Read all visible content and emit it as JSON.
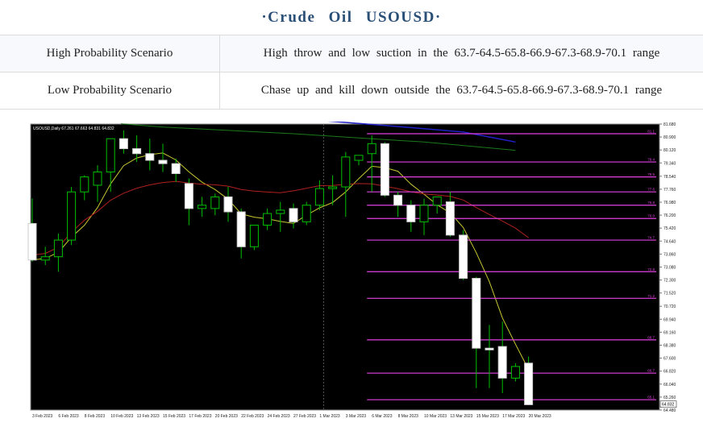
{
  "header": {
    "title": "·Crude  Oil  USOUSD·"
  },
  "scenarios": [
    {
      "label": "High Probability Scenario",
      "text": "High throw and low suction in the 63.7-64.5-65.8-66.9-67.3-68.9-70.1 range"
    },
    {
      "label": "Low Probability Scenario",
      "text": "Chase up and kill down outside the 63.7-64.5-65.8-66.9-67.3-68.9-70.1 range"
    }
  ],
  "chart_data": {
    "type": "candlestick",
    "symbol_label": "USOUSD,Daily  67.261 67.663 64.831 64.832",
    "ylim": [
      64.48,
      81.68
    ],
    "y_ticks": [
      "81.680",
      "80.900",
      "80.120",
      "79.340",
      "78.540",
      "77.760",
      "76.980",
      "76.200",
      "75.420",
      "74.640",
      "73.860",
      "73.080",
      "72.300",
      "71.520",
      "70.720",
      "69.940",
      "69.160",
      "68.380",
      "67.600",
      "66.820",
      "66.040",
      "65.260",
      "64.480"
    ],
    "current_price": "64.832",
    "x_labels": [
      "3 Feb 2023",
      "6 Feb 2023",
      "8 Feb 2023",
      "10 Feb 2023",
      "13 Feb 2023",
      "15 Feb 2023",
      "17 Feb 2023",
      "20 Feb 2023",
      "22 Feb 2023",
      "24 Feb 2023",
      "27 Feb 2023",
      "1 Mar 2023",
      "3 Mar 2023",
      "6 Mar 2023",
      "8 Mar 2023",
      "10 Mar 2023",
      "13 Mar 2023",
      "15 Mar 2023",
      "17 Mar 2023",
      "20 Mar 2023"
    ],
    "candles": [
      {
        "o": 75.7,
        "h": 77.2,
        "l": 73.4,
        "c": 73.5
      },
      {
        "o": 73.5,
        "h": 74.3,
        "l": 73.2,
        "c": 73.7
      },
      {
        "o": 73.7,
        "h": 75.1,
        "l": 72.8,
        "c": 74.7
      },
      {
        "o": 74.7,
        "h": 77.9,
        "l": 74.4,
        "c": 77.6
      },
      {
        "o": 77.6,
        "h": 78.6,
        "l": 77.1,
        "c": 78.5
      },
      {
        "o": 78.0,
        "h": 79.2,
        "l": 77.0,
        "c": 78.8
      },
      {
        "o": 78.8,
        "h": 80.5,
        "l": 77.6,
        "c": 80.8
      },
      {
        "o": 80.8,
        "h": 81.3,
        "l": 79.9,
        "c": 80.2
      },
      {
        "o": 80.2,
        "h": 81.0,
        "l": 79.4,
        "c": 79.9
      },
      {
        "o": 79.9,
        "h": 80.8,
        "l": 78.9,
        "c": 79.5
      },
      {
        "o": 79.5,
        "h": 80.5,
        "l": 78.8,
        "c": 79.3
      },
      {
        "o": 79.3,
        "h": 79.6,
        "l": 78.2,
        "c": 78.7
      },
      {
        "o": 78.1,
        "h": 78.4,
        "l": 75.6,
        "c": 76.6
      },
      {
        "o": 76.6,
        "h": 77.3,
        "l": 76.1,
        "c": 76.8
      },
      {
        "o": 76.6,
        "h": 77.5,
        "l": 76.2,
        "c": 77.3
      },
      {
        "o": 77.3,
        "h": 77.9,
        "l": 75.8,
        "c": 76.4
      },
      {
        "o": 76.4,
        "h": 76.6,
        "l": 73.6,
        "c": 74.3
      },
      {
        "o": 74.3,
        "h": 75.2,
        "l": 74.1,
        "c": 75.6
      },
      {
        "o": 75.6,
        "h": 76.6,
        "l": 75.3,
        "c": 76.3
      },
      {
        "o": 76.3,
        "h": 77.0,
        "l": 75.2,
        "c": 76.5
      },
      {
        "o": 76.6,
        "h": 76.9,
        "l": 75.4,
        "c": 75.8
      },
      {
        "o": 75.8,
        "h": 77.0,
        "l": 75.6,
        "c": 76.8
      },
      {
        "o": 76.8,
        "h": 78.3,
        "l": 76.5,
        "c": 77.8
      },
      {
        "o": 77.8,
        "h": 78.6,
        "l": 76.8,
        "c": 77.9
      },
      {
        "o": 77.9,
        "h": 80.0,
        "l": 76.1,
        "c": 79.7
      },
      {
        "o": 79.5,
        "h": 79.8,
        "l": 79.2,
        "c": 79.8
      },
      {
        "o": 79.9,
        "h": 81.0,
        "l": 77.6,
        "c": 80.5
      },
      {
        "o": 80.5,
        "h": 80.6,
        "l": 77.3,
        "c": 77.4
      },
      {
        "o": 77.4,
        "h": 77.6,
        "l": 76.1,
        "c": 76.8
      },
      {
        "o": 76.8,
        "h": 77.1,
        "l": 75.2,
        "c": 75.8
      },
      {
        "o": 75.8,
        "h": 77.2,
        "l": 75.0,
        "c": 76.8
      },
      {
        "o": 76.8,
        "h": 77.3,
        "l": 76.3,
        "c": 77.3
      },
      {
        "o": 77.0,
        "h": 77.6,
        "l": 74.9,
        "c": 75.0
      },
      {
        "o": 75.0,
        "h": 75.3,
        "l": 72.3,
        "c": 72.4
      },
      {
        "o": 72.4,
        "h": 72.5,
        "l": 65.8,
        "c": 68.2
      },
      {
        "o": 68.2,
        "h": 69.6,
        "l": 65.8,
        "c": 68.1
      },
      {
        "o": 68.3,
        "h": 69.8,
        "l": 65.5,
        "c": 66.4
      },
      {
        "o": 66.4,
        "h": 67.3,
        "l": 66.2,
        "c": 67.1
      },
      {
        "o": 67.3,
        "h": 67.7,
        "l": 64.8,
        "c": 64.8
      }
    ],
    "levels": [
      81.1,
      79.4,
      78.5,
      77.6,
      76.8,
      76.0,
      74.7,
      72.8,
      71.2,
      68.7,
      66.7,
      65.1
    ],
    "level_text": [
      "81.1",
      "79.4",
      "78.5",
      "77.6",
      "76.8",
      "76.0",
      "74.7",
      "72.8",
      "71.2",
      "68.7",
      "66.7",
      "65.1"
    ],
    "colors": {
      "bg": "#000000",
      "bull": "#00c000",
      "bear": "#ffffff",
      "level": "#e040e0",
      "ma_fast": "#c8c832",
      "ma_mid": "#b02020",
      "ma_slow": "#1a7a1a",
      "ma_long": "#2020c8",
      "axis_text": "#dddddd"
    }
  }
}
